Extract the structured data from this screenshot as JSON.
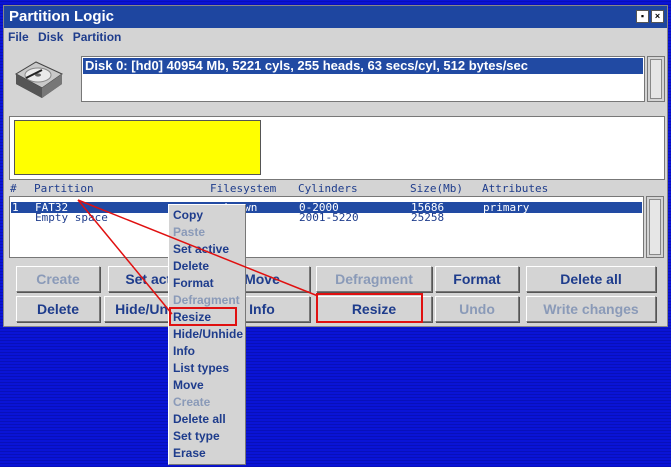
{
  "window": {
    "title": "Partition Logic"
  },
  "menu": [
    "File",
    "Disk",
    "Partition"
  ],
  "disk": {
    "row": "Disk 0: [hd0] 40954 Mb, 5221 cyls, 255 heads, 63 secs/cyl, 512 bytes/sec"
  },
  "columns": {
    "num": "#",
    "partition": "Partition",
    "filesystem": "Filesystem",
    "cylinders": "Cylinders",
    "size": "Size(Mb)",
    "attributes": "Attributes"
  },
  "partitions": [
    {
      "num": "1",
      "name": "FAT32",
      "filesystem": "unknown",
      "cylinders": "0-2000",
      "size": "15686",
      "attributes": "primary"
    },
    {
      "num": "",
      "name": "Empty space",
      "filesystem": "",
      "cylinders": "2001-5220",
      "size": "25258",
      "attributes": ""
    }
  ],
  "graph": {
    "bar_fraction": 0.383,
    "bar_color": "#ffff00"
  },
  "buttons": {
    "create": "Create",
    "set_active": "Set active",
    "move": "Move",
    "defragment": "Defragment",
    "format": "Format",
    "delete_all": "Delete all",
    "delete": "Delete",
    "hide_unhide": "Hide/Unhide",
    "info": "Info",
    "resize": "Resize",
    "undo": "Undo",
    "write_changes": "Write changes"
  },
  "context_menu": [
    {
      "label": "Copy",
      "enabled": true
    },
    {
      "label": "Paste",
      "enabled": false
    },
    {
      "label": "Set active",
      "enabled": true
    },
    {
      "label": "Delete",
      "enabled": true
    },
    {
      "label": "Format",
      "enabled": true
    },
    {
      "label": "Defragment",
      "enabled": false
    },
    {
      "label": "Resize",
      "enabled": true
    },
    {
      "label": "Hide/Unhide",
      "enabled": true
    },
    {
      "label": "Info",
      "enabled": true
    },
    {
      "label": "List types",
      "enabled": true
    },
    {
      "label": "Move",
      "enabled": true
    },
    {
      "label": "Create",
      "enabled": false
    },
    {
      "label": "Delete all",
      "enabled": true
    },
    {
      "label": "Set type",
      "enabled": true
    },
    {
      "label": "Erase",
      "enabled": true
    }
  ],
  "colors": {
    "desktop": "#0a14d6",
    "selection": "#214aa3",
    "annotation": "#e01010"
  }
}
